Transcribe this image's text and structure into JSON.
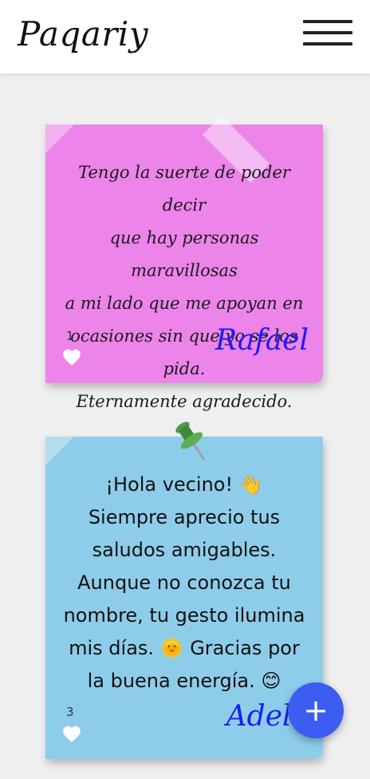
{
  "header": {
    "logo": "Paqariy",
    "menu_icon": "hamburger-icon"
  },
  "notes": [
    {
      "text_lines": [
        "Tengo la suerte de poder decir",
        "que hay personas maravillosas",
        "a mi lado que me apoyan en",
        "ocasiones sin que yo se los pida.",
        "Eternamente agradecido."
      ],
      "likes": "1",
      "author": "Rafael",
      "color": "#ec84ea",
      "decoration": "tape"
    },
    {
      "text_lines": [
        "¡Hola vecino! 👋",
        "Siempre aprecio tus",
        "saludos amigables.",
        "Aunque no conozca tu",
        "nombre, tu gesto ilumina",
        "mis días. 🌞 Gracias por",
        "la buena energía. 😊"
      ],
      "likes": "3",
      "author": "Adela",
      "color": "#8ecdea",
      "decoration": "pushpin-icon"
    }
  ],
  "fab": {
    "label": "+",
    "icon": "plus-icon",
    "color": "#3d5cf2"
  }
}
